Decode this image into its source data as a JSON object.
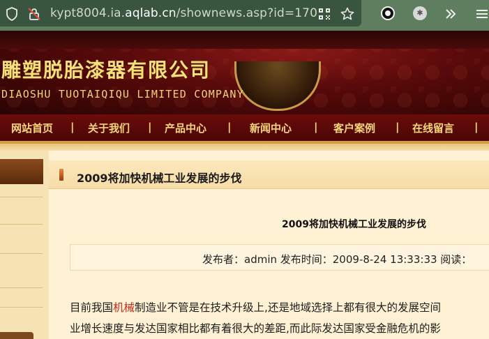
{
  "browser": {
    "url_prefix": "kypt8004.ia.",
    "url_domain": "aqlab.cn",
    "url_path": "/shownews.asp?id=170",
    "icons": [
      "shield-icon",
      "insecure-lock-icon",
      "qr-code-icon",
      "star-icon",
      "dark-mode-extension-icon",
      "extension-icon",
      "overflow-chevrons-icon",
      "menu-icon"
    ]
  },
  "site": {
    "company_cn": "雕塑脱胎漆器有限公司",
    "company_en": "DIAOSHU  TUOTAIQIQU  LIMITED  COMPANY"
  },
  "nav": {
    "items": [
      {
        "label": "网站首页"
      },
      {
        "label": "关于我们"
      },
      {
        "label": "产品中心"
      },
      {
        "label": "新闻中心"
      },
      {
        "label": "客户案例"
      },
      {
        "label": "在线留言"
      }
    ],
    "separator": "|"
  },
  "article": {
    "page_title": "2009将加快机械工业发展的步伐",
    "title": "2009将加快机械工业发展的步伐",
    "meta": "发布者：admin 发布时间：2009-8-24 13:33:33 阅读：",
    "body_line1_pre": "目前我国",
    "body_line1_kw": "机械",
    "body_line1_post": "制造业不管是在技术升级上,还是地域选择上都有很大的发展空间",
    "body_line2": "业增长速度与发达国家相比都有着很大的差距,而此际发达国家受金融危机的影"
  },
  "colors": {
    "chrome_bg": "#5f7d5f",
    "urlbar_bg": "#39553f",
    "banner_red": "#5a0a0a",
    "gold_text": "#f6e07a",
    "keyword_red": "#c9261e"
  }
}
